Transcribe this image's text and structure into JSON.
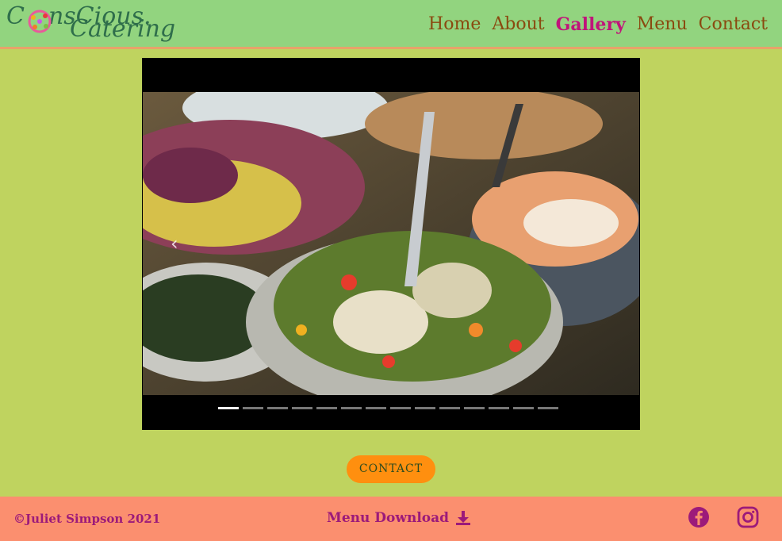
{
  "brand": {
    "logo_text_top": "Cnscious.",
    "logo_text_bottom": "Catering"
  },
  "nav": {
    "items": [
      {
        "label": "Home",
        "active": false
      },
      {
        "label": "About",
        "active": false
      },
      {
        "label": "Gallery",
        "active": true
      },
      {
        "label": "Menu",
        "active": false
      },
      {
        "label": "Contact",
        "active": false
      }
    ]
  },
  "carousel": {
    "image_alt": "Salad buffet with bowls of grilled vegetables",
    "prev_icon": "chevron-left-icon",
    "indicator_count": 14,
    "active_index": 0
  },
  "cta": {
    "label": "CONTACT"
  },
  "footer": {
    "copyright": "©Juliet Simpson 2021",
    "menu_download": "Menu Download",
    "download_icon": "download-icon",
    "social": [
      "facebook-icon",
      "instagram-icon"
    ]
  },
  "colors": {
    "page_bg": "#bfd35f",
    "nav_bg": "#92d47f",
    "nav_link": "#8a4a10",
    "nav_active": "#c0147a",
    "cta_bg": "#ff8f0f",
    "footer_bg": "#fb8f6f",
    "footer_text": "#9c1a7a"
  }
}
